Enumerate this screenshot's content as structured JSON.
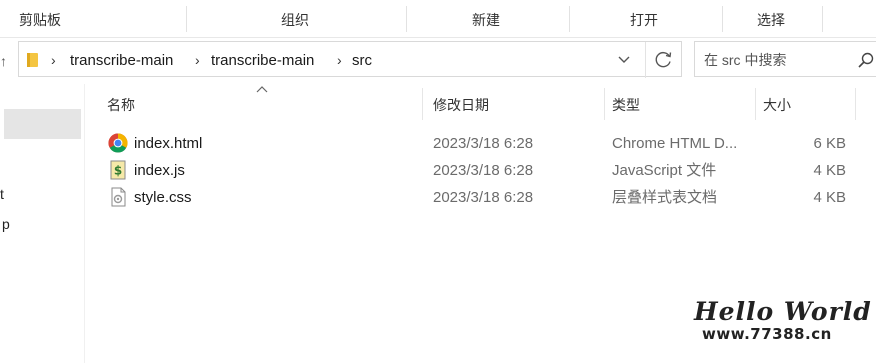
{
  "ribbon": {
    "clipboard": "剪贴板",
    "organize": "组织",
    "new": "新建",
    "open": "打开",
    "select": "选择"
  },
  "address": {
    "up_glyph": "↑",
    "crumbs": [
      "transcribe-main",
      "transcribe-main",
      "src"
    ],
    "separator": "›"
  },
  "search": {
    "placeholder": "在 src 中搜索"
  },
  "nav_pane": {
    "fragments": [
      "t",
      "p"
    ]
  },
  "columns": {
    "name": "名称",
    "modified": "修改日期",
    "type": "类型",
    "size": "大小"
  },
  "files": [
    {
      "name": "index.html",
      "modified": "2023/3/18 6:28",
      "type": "Chrome HTML D...",
      "size": "6 KB",
      "icon": "chrome-icon"
    },
    {
      "name": "index.js",
      "modified": "2023/3/18 6:28",
      "type": "JavaScript 文件",
      "size": "4 KB",
      "icon": "js-script-icon"
    },
    {
      "name": "style.css",
      "modified": "2023/3/18 6:28",
      "type": "层叠样式表文档",
      "size": "4 KB",
      "icon": "css-file-icon"
    }
  ],
  "watermark": {
    "title": "Hello World",
    "url": "www.77388.cn"
  },
  "colors": {
    "selection": "#e5e5e5",
    "folder": "#f4c542",
    "chrome_red": "#db4437",
    "chrome_yellow": "#f4b400",
    "chrome_green": "#0f9d58",
    "chrome_blue": "#4285f4"
  }
}
